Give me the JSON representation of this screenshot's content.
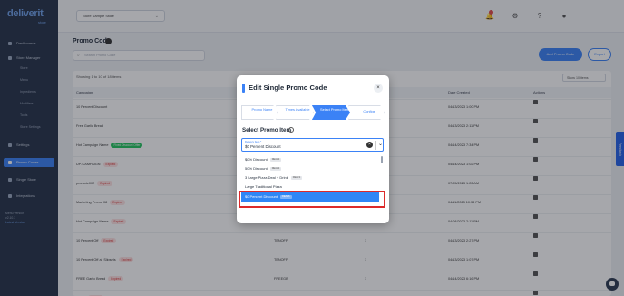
{
  "app": {
    "logo": "deliverit",
    "logo_sub": "store"
  },
  "sidebar": {
    "items": [
      {
        "label": "Dashboards",
        "active": false
      },
      {
        "label": "Store Manager",
        "active": false
      },
      {
        "label": "Settings",
        "active": false
      },
      {
        "label": "Promo Codes",
        "active": true
      },
      {
        "label": "Single Store",
        "active": false
      },
      {
        "label": "Integrations",
        "active": false
      }
    ],
    "subitems": [
      "Store",
      "Menu",
      "Ingredients",
      "Modifiers",
      "Tools",
      "Store Settings"
    ],
    "footer": [
      "Menu Version",
      "v2.10.3",
      "Latest Version"
    ]
  },
  "topbar": {
    "store_select": "Store Sample Store",
    "notifications": "1"
  },
  "page": {
    "title": "Promo Code",
    "search_placeholder": "Search Promo Code",
    "add_button": "Add Promo Code",
    "export_button": "Export",
    "showing": "Showing 1 to 10 of 18 items",
    "show_entries": "Show 10 items"
  },
  "table": {
    "headers": [
      "Campaign",
      "Code",
      "Used",
      "Date Created",
      "Actions"
    ],
    "rows": [
      {
        "name": "10 Percent Discount",
        "badge": "",
        "code": "",
        "used": "",
        "date": "04/13/2023 1:00 PM"
      },
      {
        "name": "Free Garlic Bread",
        "badge": "",
        "code": "",
        "used": "",
        "date": "04/13/2023 2:11 PM"
      },
      {
        "name": "Hot Campaign Name",
        "badge": "Fixed Discount Offer",
        "badge_type": "green",
        "code": "",
        "used": "",
        "date": "04/14/2023 7:34 PM"
      },
      {
        "name": "UP-CAMPAIGN",
        "badge": "Expired",
        "badge_type": "red",
        "code": "",
        "used": "",
        "date": "04/14/2023 1:02 PM"
      },
      {
        "name": "promote002",
        "badge": "Expired",
        "badge_type": "red",
        "code": "",
        "used": "",
        "date": "07/05/2023 1:22 AM"
      },
      {
        "name": "Marketing Promo 08",
        "badge": "Expired",
        "badge_type": "red",
        "code": "",
        "used": "",
        "date": "04/11/2023 10:33 PM"
      },
      {
        "name": "Hot Campaign Name",
        "badge": "Expired",
        "badge_type": "red",
        "code": "",
        "used": "",
        "date": "04/08/2023 2:11 PM"
      },
      {
        "name": "10 Percent Off",
        "badge": "Expired",
        "badge_type": "red",
        "code": "TENOFF",
        "used": "1",
        "date": "04/13/2023 2:27 PM"
      },
      {
        "name": "10 Percent Off all Slipsets",
        "badge": "Expired",
        "badge_type": "red",
        "code": "TENOFF",
        "used": "1",
        "date": "04/13/2023 1:07 PM"
      },
      {
        "name": "FREE Garlic Bread",
        "badge": "Expired",
        "badge_type": "red",
        "code": "FREEGB",
        "used": "1",
        "date": "04/14/2023 6:16 PM"
      },
      {
        "name": "FREE",
        "badge": "Expired",
        "badge_type": "red",
        "code": "FREEGAL",
        "used": "1",
        "date": "04/15/2023 5:43 PM"
      }
    ]
  },
  "modal": {
    "title": "Edit Single Promo Code",
    "close": "×",
    "steps": [
      {
        "num": "1",
        "label": "Promo Name",
        "active": false
      },
      {
        "num": "2",
        "label": "Times Available",
        "active": false
      },
      {
        "num": "3",
        "label": "Select Promo Item",
        "active": true
      },
      {
        "num": "4",
        "label": "Configs",
        "active": false
      }
    ],
    "section_label": "Select Promo Item",
    "field_label": "Delivery Item *",
    "field_value": "$0 Percent Discount",
    "options": [
      {
        "label": "$0% Discount",
        "tag": "DEALS"
      },
      {
        "label": "50% Discount",
        "tag": "DEALS"
      },
      {
        "label": "3 Large Pizza Deal + Drink",
        "tag": "DEALS"
      },
      {
        "label": "Large Traditional Pizza",
        "tag": ""
      },
      {
        "label": "$0 Percent Discount",
        "tag": "DEALS",
        "selected": true
      }
    ]
  },
  "feedback": {
    "label": "Feedback"
  },
  "colors": {
    "accent": "#3b82f6",
    "sidebar": "#26334a",
    "highlight": "#dc2a2a"
  }
}
